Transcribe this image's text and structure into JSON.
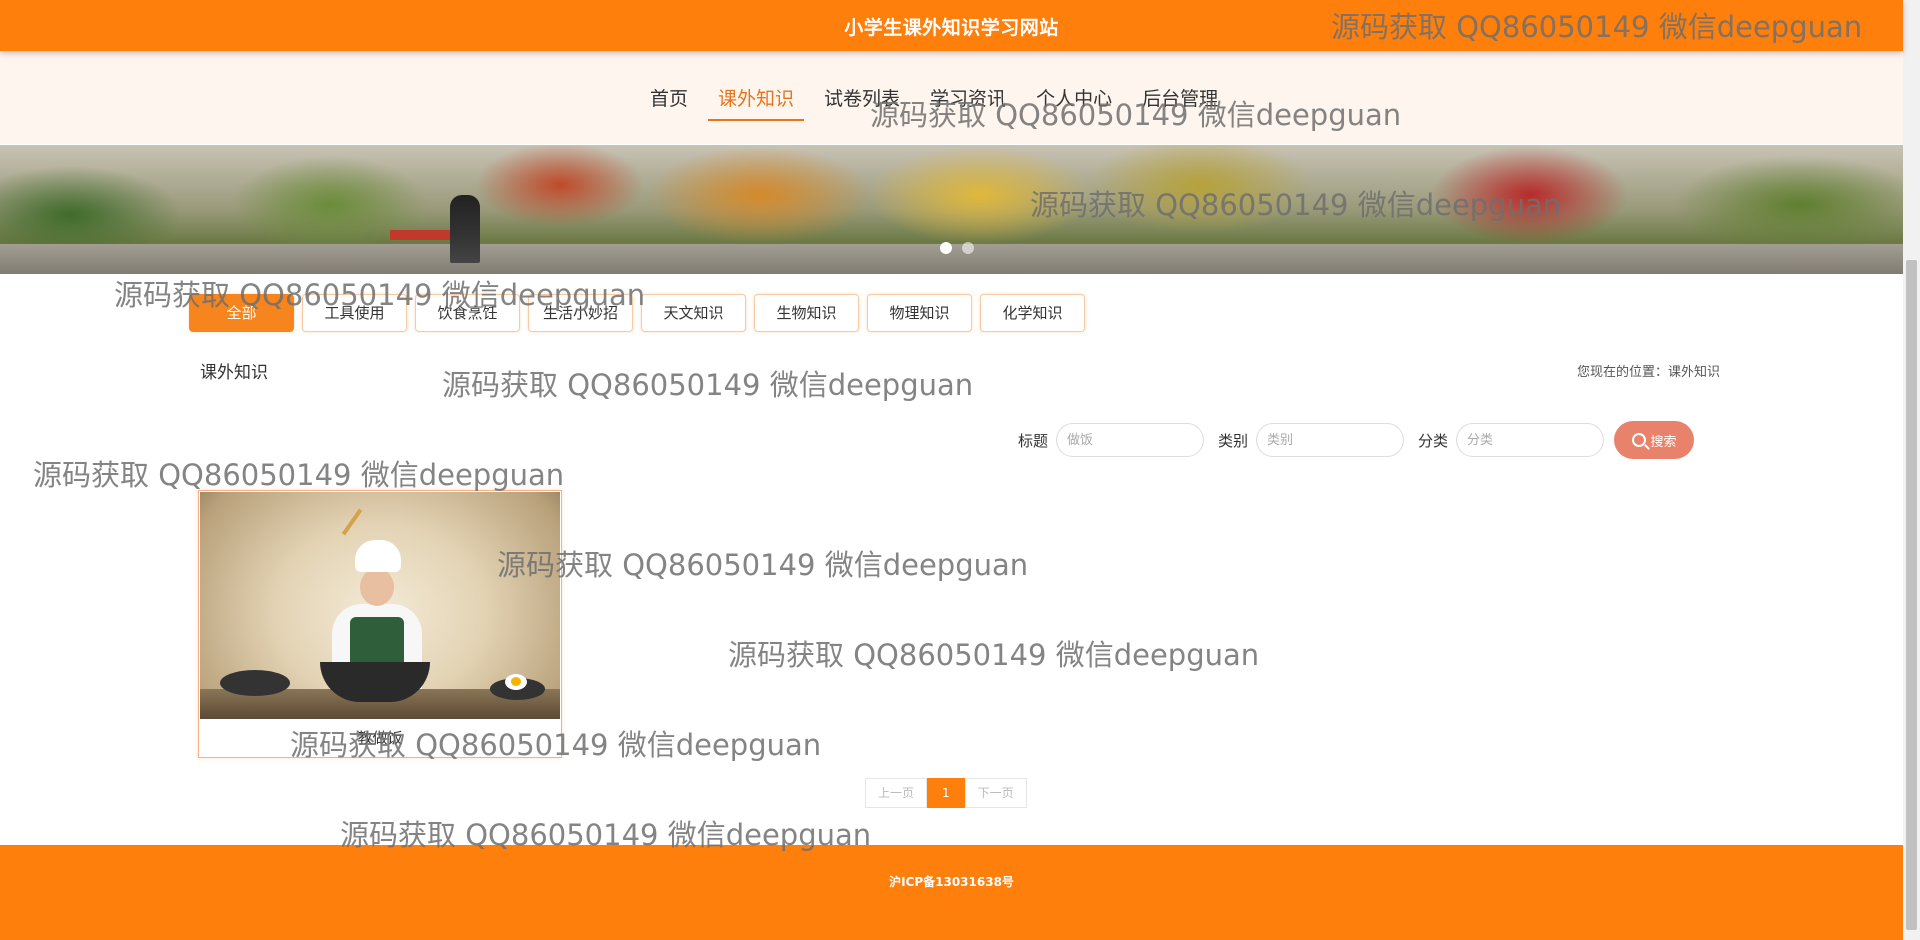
{
  "header": {
    "site_title": "小学生课外知识学习网站"
  },
  "nav": {
    "items": [
      "首页",
      "课外知识",
      "试卷列表",
      "学习资讯",
      "个人中心",
      "后台管理"
    ],
    "active_index": 1
  },
  "banner": {
    "slide_count": 2,
    "active_slide": 1
  },
  "categories": {
    "items": [
      "全部",
      "工具使用",
      "饮食烹饪",
      "生活小妙招",
      "天文知识",
      "生物知识",
      "物理知识",
      "化学知识"
    ],
    "active_index": 0
  },
  "section": {
    "title": "课外知识",
    "breadcrumb": "您现在的位置：课外知识"
  },
  "search": {
    "title_label": "标题",
    "title_placeholder": "做饭",
    "type_label": "类别",
    "type_placeholder": "类别",
    "category_label": "分类",
    "category_placeholder": "分类",
    "button_label": "搜索"
  },
  "cards": [
    {
      "title": "教做饭"
    }
  ],
  "pagination": {
    "prev_label": "上一页",
    "current_page": "1",
    "next_label": "下一页"
  },
  "footer": {
    "icp_text": "沪ICP备13031638号"
  },
  "watermark": {
    "text": "源码获取 QQ86050149 微信deepguan"
  },
  "colors": {
    "brand_orange": "#fe7f0c",
    "nav_background": "#fef6ee",
    "search_button": "#e8826a"
  }
}
